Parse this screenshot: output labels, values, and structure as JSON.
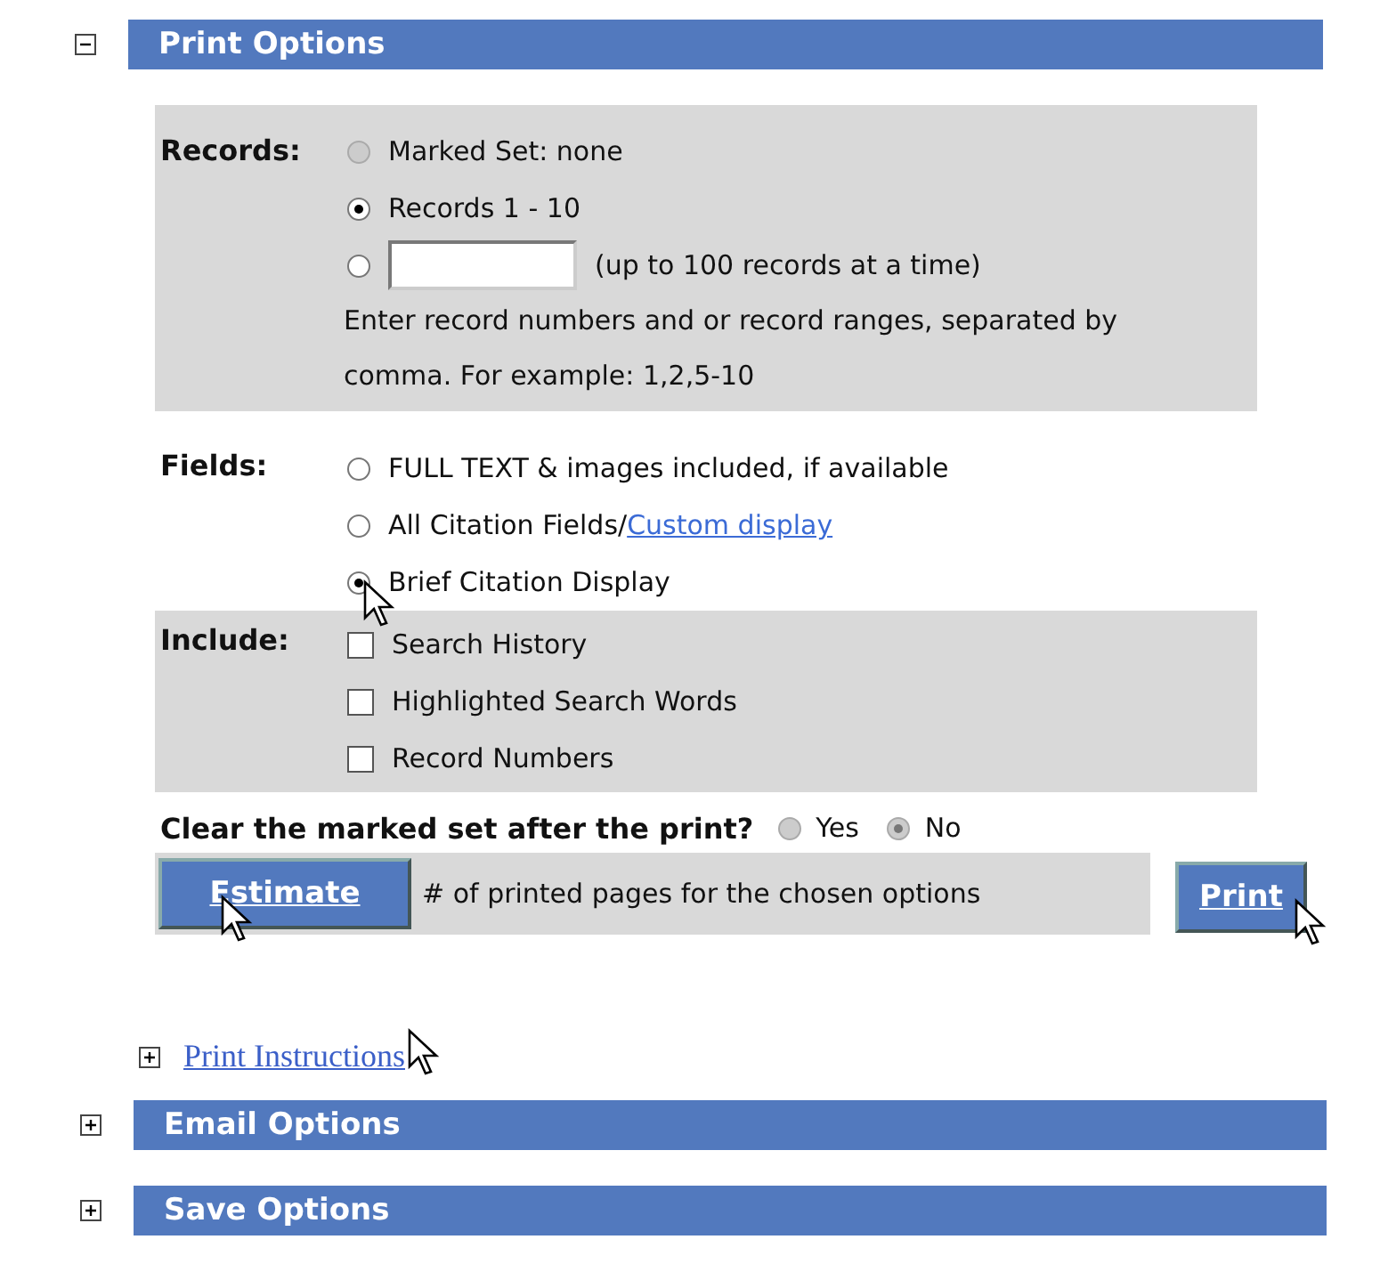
{
  "print_options": {
    "title": "Print Options",
    "expanded": true,
    "records": {
      "label": "Records:",
      "options": [
        {
          "kind": "radio",
          "label": "Marked Set: none",
          "selected": false,
          "disabled": true
        },
        {
          "kind": "radio",
          "label": "Records 1 - 10",
          "selected": true,
          "disabled": false
        },
        {
          "kind": "input",
          "label": "(up to 100 records at a time)",
          "selected": false,
          "disabled": false
        }
      ],
      "hint": "Enter record numbers and or record ranges, separated by comma. For example: 1,2,5-10"
    },
    "fields": {
      "label": "Fields:",
      "options": [
        {
          "label": "FULL TEXT & images included, if available",
          "selected": false
        },
        {
          "label": "All Citation Fields/",
          "link": "Custom display",
          "selected": false
        },
        {
          "label": "Brief Citation Display",
          "selected": true
        }
      ]
    },
    "include": {
      "label": "Include:",
      "options": [
        {
          "label": "Search History",
          "checked": false
        },
        {
          "label": "Highlighted Search Words",
          "checked": false
        },
        {
          "label": "Record Numbers",
          "checked": false
        }
      ]
    },
    "clear": {
      "label": "Clear the marked set after the print?",
      "options": [
        {
          "label": "Yes",
          "selected": false,
          "disabled": true
        },
        {
          "label": "No",
          "selected": true,
          "disabled": true
        }
      ]
    },
    "estimate": {
      "button": "Estimate",
      "description": "# of printed pages for the chosen options"
    },
    "print_button": "Print"
  },
  "print_instructions": {
    "label": "Print Instructions",
    "expanded": false
  },
  "sections": [
    {
      "title": "Email Options",
      "expanded": false
    },
    {
      "title": "Save Options",
      "expanded": false
    }
  ]
}
